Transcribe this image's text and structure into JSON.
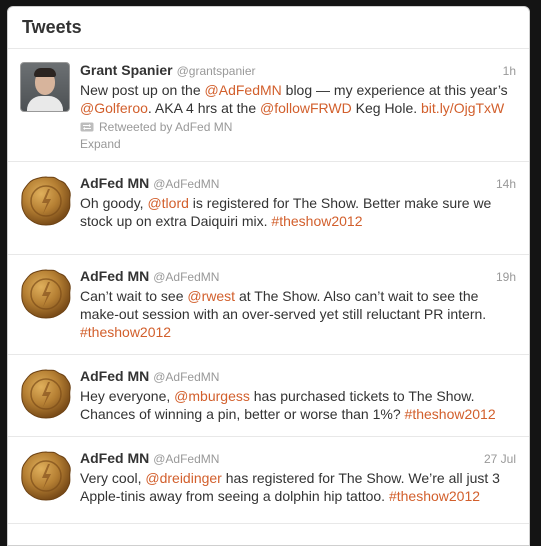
{
  "panel": {
    "title": "Tweets"
  },
  "tweets": [
    {
      "name": "Grant Spanier",
      "handle": "@grantspanier",
      "time": "1h",
      "text": {
        "p1": "New post up on the ",
        "m1": "@AdFedMN",
        "p2": " blog — my experience at this year’s ",
        "m2": "@Golferoo",
        "p3": ". AKA 4 hrs at the ",
        "m3": "@followFRWD",
        "p4": " Keg Hole. ",
        "link": "bit.ly/OjgTxW"
      },
      "retweeted_by": "Retweeted by AdFed MN",
      "expand": "Expand"
    },
    {
      "name": "AdFed MN",
      "handle": "@AdFedMN",
      "time": "14h",
      "text": {
        "p1": "Oh goody, ",
        "m1": "@tlord",
        "p2": " is registered for The Show. Better make sure we stock up on extra Daiquiri mix. ",
        "h1": "#theshow2012"
      }
    },
    {
      "name": "AdFed MN",
      "handle": "@AdFedMN",
      "time": "19h",
      "text": {
        "p1": "Can’t wait to see ",
        "m1": "@rwest",
        "p2": " at The Show. Also can’t wait to see the make-out session with an over-served yet still reluctant PR intern. ",
        "h1": "#theshow2012"
      }
    },
    {
      "name": "AdFed MN",
      "handle": "@AdFedMN",
      "time": "",
      "text": {
        "p1": "Hey everyone, ",
        "m1": "@mburgess",
        "p2": " has purchased tickets to The Show. Chances of winning a pin, better or worse than 1%? ",
        "h1": "#theshow2012"
      }
    },
    {
      "name": "AdFed MN",
      "handle": "@AdFedMN",
      "time": "27 Jul",
      "text": {
        "p1": "Very cool, ",
        "m1": "@dreidinger",
        "p2": " has registered for The Show. We’re all just 3 Apple-tinis away from seeing a dolphin hip tattoo. ",
        "h1": "#theshow2012"
      }
    }
  ],
  "icons": {
    "retweet": "retweet-icon",
    "seal": "wax-seal-icon"
  },
  "colors": {
    "link": "#d25f2c",
    "seal": "#a8742d",
    "background": "#141414"
  }
}
